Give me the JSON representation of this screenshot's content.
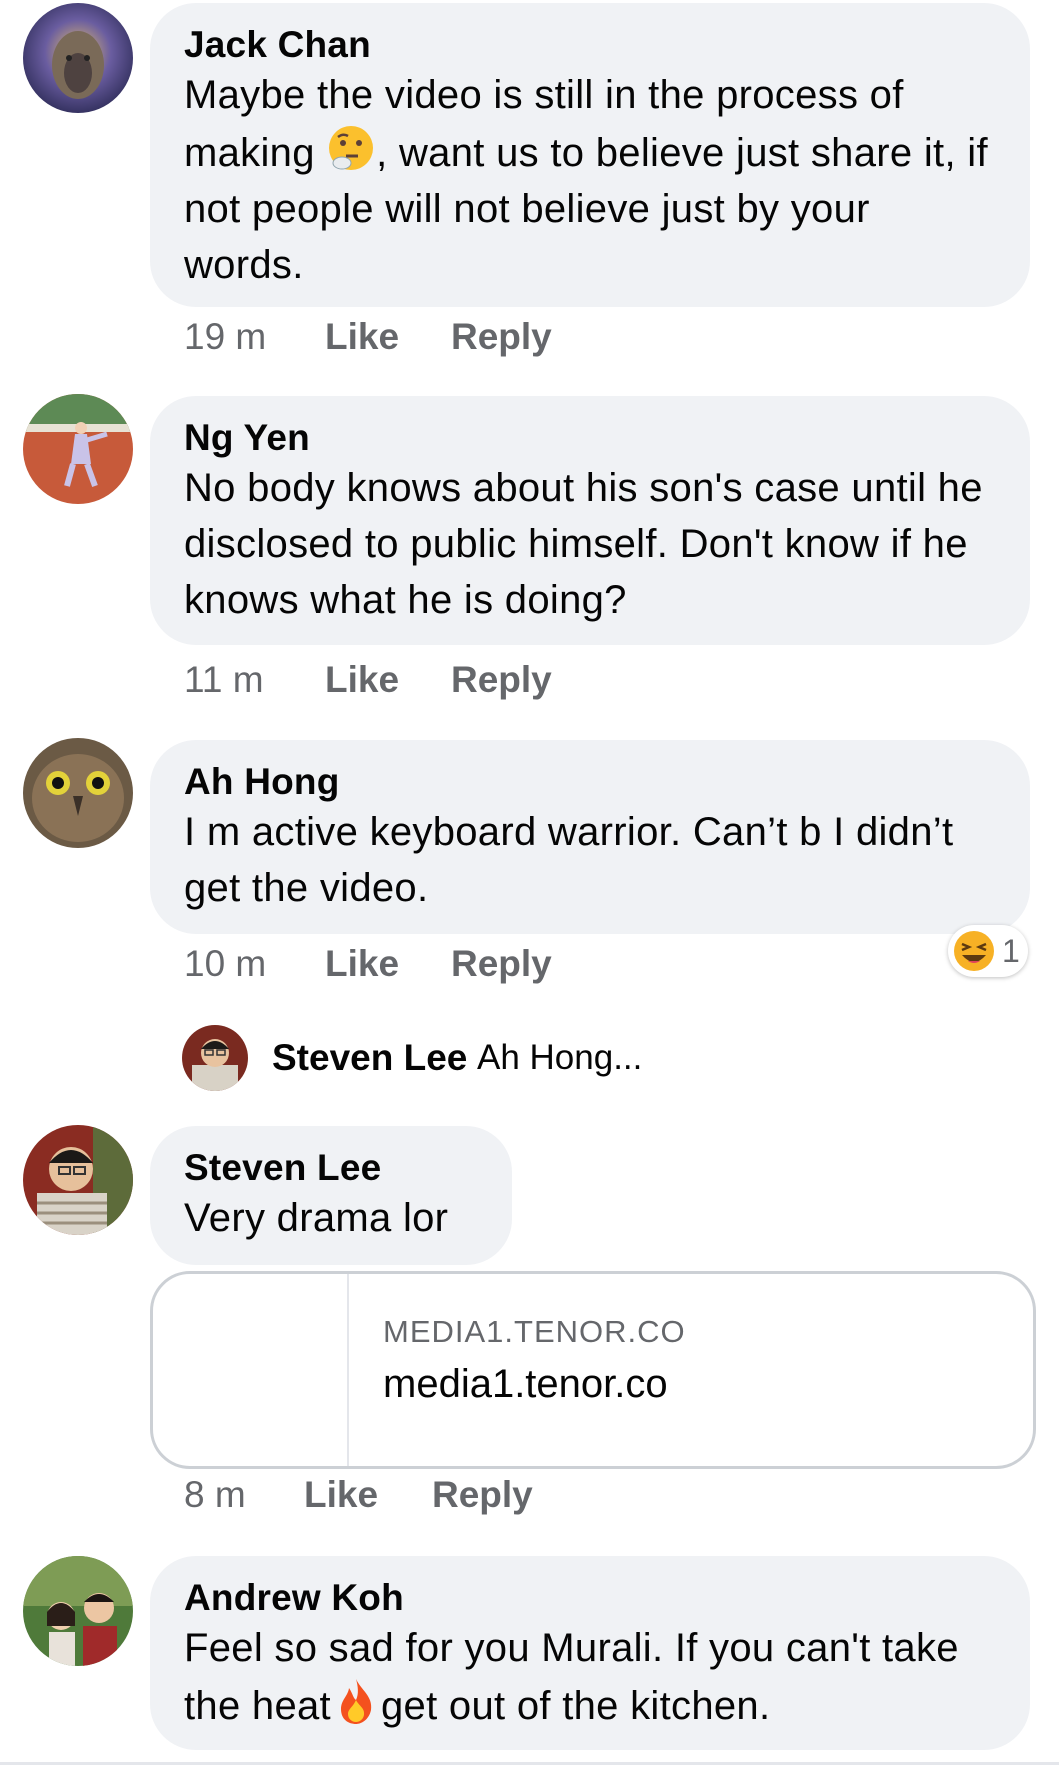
{
  "comments": [
    {
      "author": "Jack Chan",
      "text_part1": "Maybe the video is still in the process of making ",
      "emoji": "thinking-face",
      "text_part2": ", want us to believe just share it, if not people will not believe just by your words.",
      "time": "19 m",
      "like": "Like",
      "reply": "Reply"
    },
    {
      "author": "Ng Yen",
      "text": "No body knows about his son's case until he disclosed to public himself. Don't know if he knows what he is doing?",
      "time": "11 m",
      "like": "Like",
      "reply": "Reply"
    },
    {
      "author": "Ah Hong",
      "text": "I m active keyboard warrior. Can’t b I didn’t get the video.",
      "time": "10 m",
      "like": "Like",
      "reply": "Reply",
      "reaction": {
        "emoji": "laughing-face",
        "count": "1"
      },
      "reply_preview": {
        "author": "Steven Lee",
        "text": "Ah Hong..."
      }
    },
    {
      "author": "Steven Lee",
      "text": "Very drama lor",
      "link": {
        "domain": "MEDIA1.TENOR.CO",
        "title": "media1.tenor.co"
      },
      "time": "8 m",
      "like": "Like",
      "reply": "Reply"
    },
    {
      "author": "Andrew Koh",
      "text_part1": "Feel so sad for you Murali. If you can't take the heat",
      "emoji": "fire",
      "text_part2": "get out of the kitchen."
    }
  ],
  "colors": {
    "bubble": "#f0f2f5",
    "meta_text": "#65676b",
    "primary_text": "#050505"
  }
}
